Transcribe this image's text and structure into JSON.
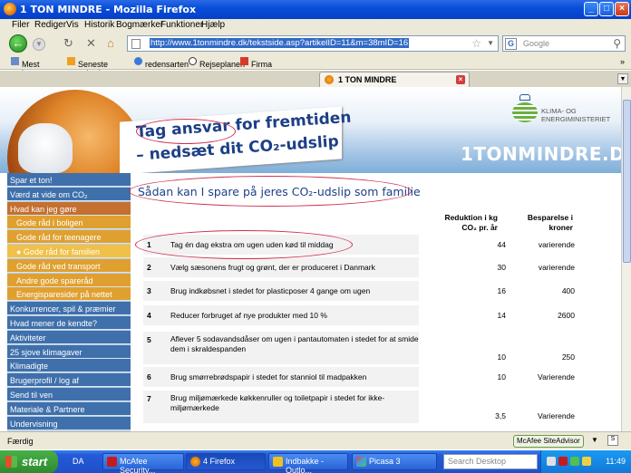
{
  "window": {
    "title": "1 TON MINDRE - Mozilla Firefox",
    "minimize": "_",
    "maximize": "□",
    "close": "×"
  },
  "menu": [
    "Filer",
    "Rediger",
    "Vis",
    "Historik",
    "Bogmærker",
    "Funktioner",
    "Hjælp"
  ],
  "nav": {
    "url": "http://www.1tonmindre.dk/tekstside.asp?artikelID=11&m=38mID=16",
    "search_placeholder": "Google",
    "search_engine": "G"
  },
  "bookmarks": [
    "Mest besøgte",
    "Seneste nyheder",
    "redensarten",
    "Rejseplanen",
    "Firma -"
  ],
  "tab": {
    "label": "1 TON MINDRE",
    "close": "×"
  },
  "banner": {
    "slogan_line1": "Tag ansvar for fremtiden",
    "slogan_line2": "– nedsæt dit CO₂-udslip",
    "ministry": "KLIMA- OG ENERGIMINISTERIET",
    "site_name": "1TONMINDRE.DK"
  },
  "sidebar": [
    {
      "label": "Spar et ton!",
      "kind": "top"
    },
    {
      "label": "Værd at vide om CO₂",
      "kind": "top"
    },
    {
      "label": "Hvad kan jeg gøre",
      "kind": "active"
    },
    {
      "label": "Gode råd i boligen",
      "kind": "sub"
    },
    {
      "label": "Gode råd for teenagere",
      "kind": "sub"
    },
    {
      "label": "● Gode råd for familien",
      "kind": "selected"
    },
    {
      "label": "Gode råd ved transport",
      "kind": "sub"
    },
    {
      "label": "Andre gode spareråd",
      "kind": "sub"
    },
    {
      "label": "Energisparesider på nettet",
      "kind": "sub"
    },
    {
      "label": "Konkurrencer, spil & præmier",
      "kind": "top"
    },
    {
      "label": "Hvad mener de kendte?",
      "kind": "top"
    },
    {
      "label": "Aktiviteter",
      "kind": "top"
    },
    {
      "label": "25 sjove klimagaver",
      "kind": "top"
    },
    {
      "label": "Klimadigte",
      "kind": "top"
    },
    {
      "label": "Brugerprofil / log af",
      "kind": "top"
    },
    {
      "label": "Send til ven",
      "kind": "top"
    },
    {
      "label": "Materiale & Partnere",
      "kind": "top"
    },
    {
      "label": "Undervisning",
      "kind": "top"
    }
  ],
  "main": {
    "heading": "Sådan kan I spare på jeres CO₂-udslip som familie",
    "col_reduction": "Reduktion i kg CO₂ pr. år",
    "col_savings": "Besparelse i kroner",
    "rows": [
      {
        "n": "1",
        "text": "Tag én dag ekstra om ugen uden kød til middag",
        "red": "44",
        "sav": "varierende"
      },
      {
        "n": "2",
        "text": "Vælg sæsonens frugt og grønt, der er produceret i Danmark",
        "red": "30",
        "sav": "varierende"
      },
      {
        "n": "3",
        "text": "Brug indkøbsnet i stedet for plasticposer 4 gange om ugen",
        "red": "16",
        "sav": "400"
      },
      {
        "n": "4",
        "text": "Reducer forbruget af nye produkter med 10 %",
        "red": "14",
        "sav": "2600"
      },
      {
        "n": "5",
        "text": "Aflever 5 sodavandsdåser om ugen i pantautomaten i stedet for at smide dem i skraldespanden",
        "red": "10",
        "sav": "250"
      },
      {
        "n": "6",
        "text": "Brug smørrebrødspapir i stedet for stanniol til madpakken",
        "red": "10",
        "sav": "Varierende"
      },
      {
        "n": "7",
        "text": "Brug miljømærkede køkkenruller og toiletpapir i stedet for ikke-miljømærkede",
        "red": "3,5",
        "sav": "Varierende"
      }
    ]
  },
  "status": {
    "text": "Færdig",
    "advisor": "McAfee SiteAdvisor"
  },
  "taskbar": {
    "start": "start",
    "lang": "DA",
    "items": [
      "McAfee Security...",
      "4 Firefox",
      "Indbakke - Outlo...",
      "Picasa 3"
    ],
    "search_placeholder": "Search Desktop",
    "clock": "11:49"
  }
}
